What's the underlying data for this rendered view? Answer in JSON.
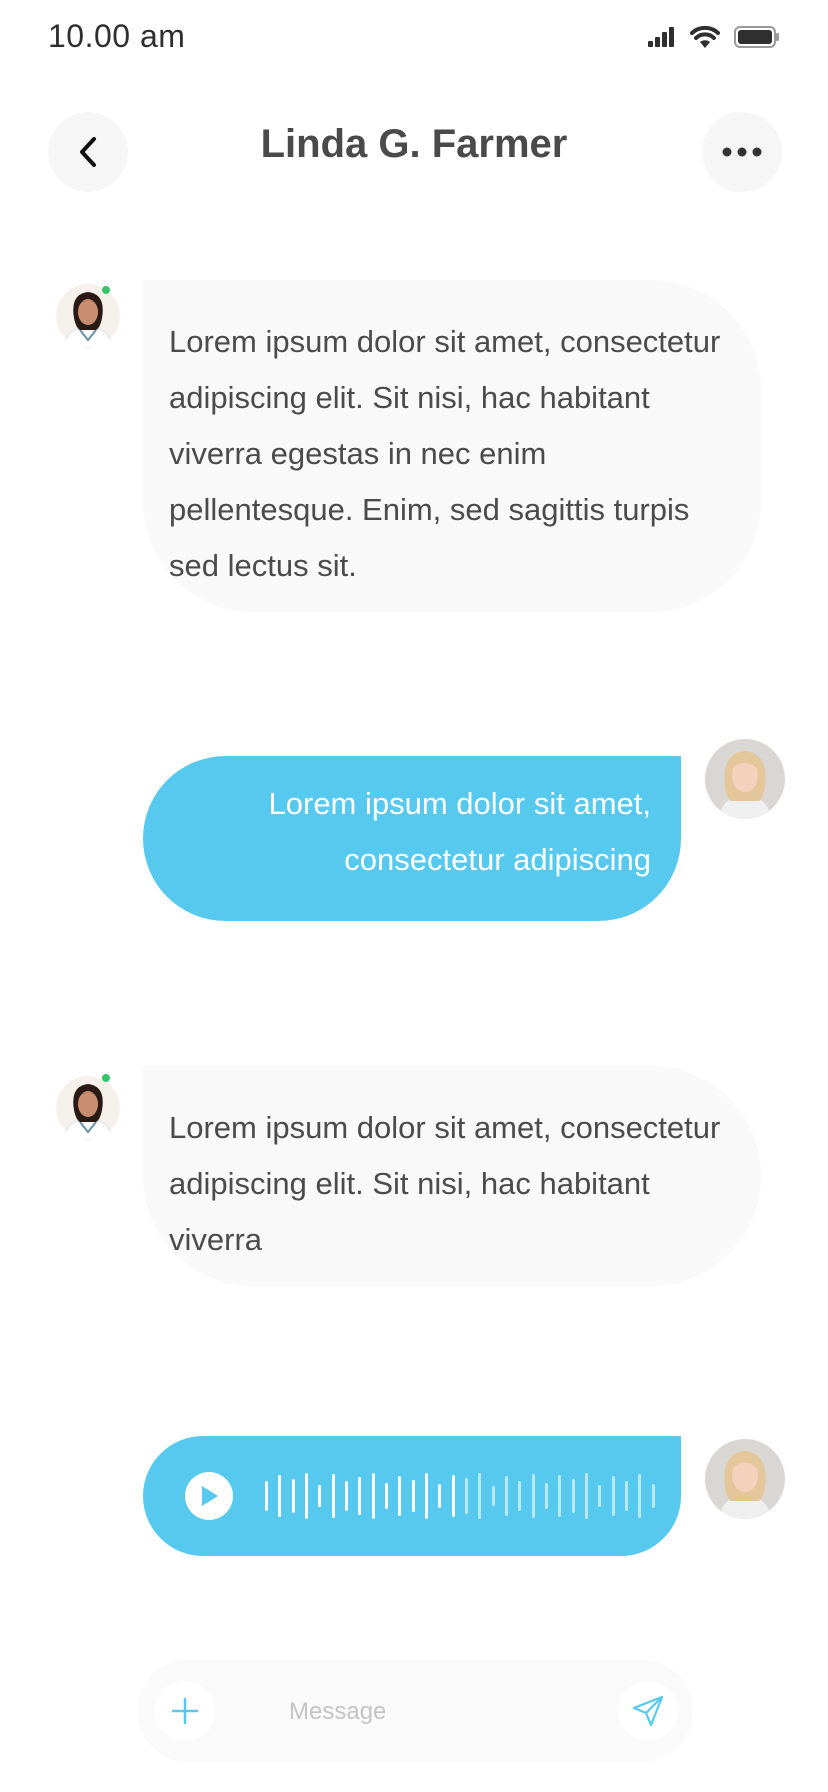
{
  "status_bar": {
    "time": "10.00 am"
  },
  "header": {
    "title": "Linda G. Farmer"
  },
  "messages": [
    {
      "text": "Lorem ipsum dolor sit amet, consectetur adipiscing elit. Sit nisi, hac habitant viverra egestas in nec enim pellentesque. Enim, sed sagittis turpis sed lectus sit."
    },
    {
      "text": "Lorem ipsum dolor sit amet, consectetur adipiscing"
    },
    {
      "text": "Lorem ipsum dolor sit amet, consectetur adipiscing elit. Sit nisi, hac habitant viverra"
    }
  ],
  "voice_message": {
    "played_fraction": 0.5
  },
  "composer": {
    "placeholder": "Message"
  },
  "colors": {
    "accent": "#57c9ef",
    "incoming_bubble": "#f9f9f9",
    "online": "#35c46a"
  },
  "icons": {
    "back": "chevron-left-icon",
    "more": "more-horizontal-icon",
    "play": "play-icon",
    "add": "plus-icon",
    "send": "send-icon"
  }
}
